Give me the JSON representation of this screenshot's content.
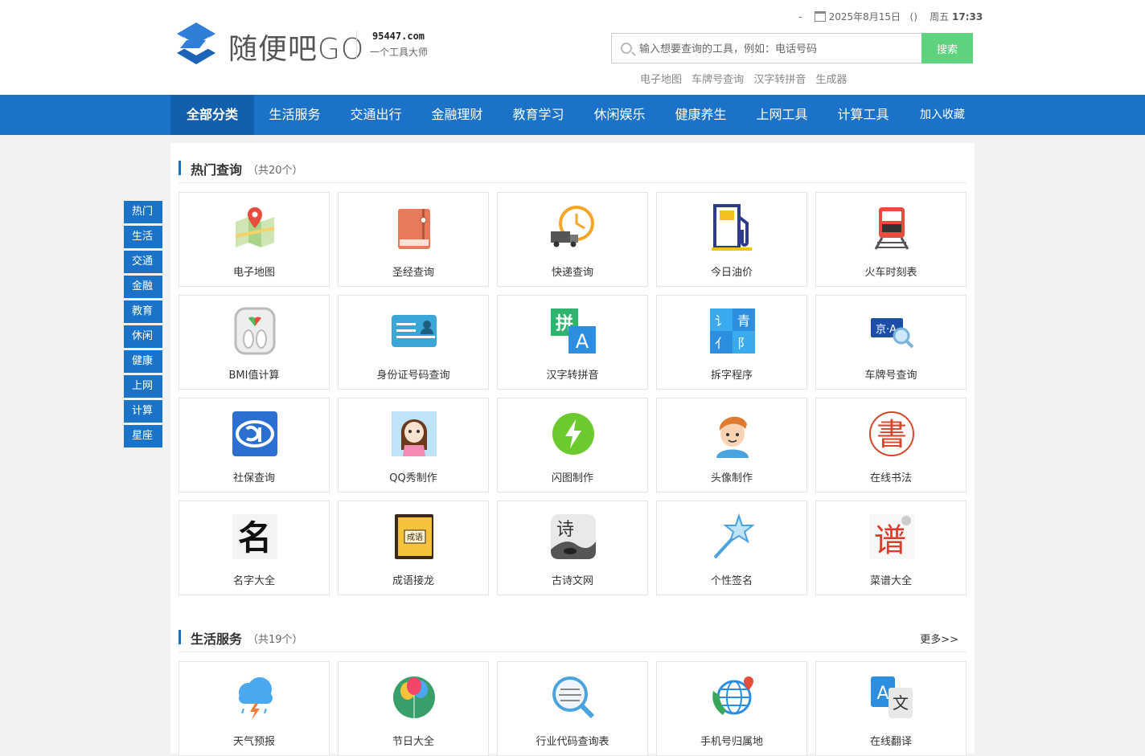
{
  "header": {
    "logo_text": "随便吧GO",
    "domain": "95447.com",
    "slogan": "一个工具大师",
    "date_prefix": "-",
    "date": "2025年8月15日",
    "date_paren": "()",
    "weekday": "周五",
    "time": "17:33",
    "search_placeholder": "输入想要查询的工具，例如：电话号码",
    "search_button": "搜索",
    "quick_links": [
      "电子地图",
      "车牌号查询",
      "汉字转拼音",
      "生成器"
    ]
  },
  "nav": {
    "items": [
      "全部分类",
      "生活服务",
      "交通出行",
      "金融理财",
      "教育学习",
      "休闲娱乐",
      "健康养生",
      "上网工具",
      "计算工具",
      "加入收藏"
    ]
  },
  "sidebar": {
    "items": [
      "热门",
      "生活",
      "交通",
      "金融",
      "教育",
      "休闲",
      "健康",
      "上网",
      "计算",
      "星座"
    ]
  },
  "sections": {
    "hot": {
      "title": "热门查询",
      "count": "（共20个）",
      "tools": [
        "电子地图",
        "圣经查询",
        "快递查询",
        "今日油价",
        "火车时刻表",
        "BMI值计算",
        "身份证号码查询",
        "汉字转拼音",
        "拆字程序",
        "车牌号查询",
        "社保查询",
        "QQ秀制作",
        "闪图制作",
        "头像制作",
        "在线书法",
        "名字大全",
        "成语接龙",
        "古诗文网",
        "个性签名",
        "菜谱大全"
      ]
    },
    "life": {
      "title": "生活服务",
      "count": "（共19个）",
      "more": "更多>>",
      "tools": [
        "天气预报",
        "节日大全",
        "行业代码查询表",
        "手机号归属地",
        "在线翻译"
      ]
    }
  },
  "icons": {
    "hot": [
      "map-icon",
      "bible-icon",
      "express-icon",
      "fuel-icon",
      "train-icon",
      "scale-icon",
      "id-card-icon",
      "pinyin-icon",
      "split-char-icon",
      "plate-search-icon",
      "social-security-icon",
      "qq-show-icon",
      "flash-icon",
      "avatar-icon",
      "calligraphy-icon",
      "name-icon",
      "idiom-book-icon",
      "poem-icon",
      "star-wand-icon",
      "recipe-icon"
    ],
    "life": [
      "weather-icon",
      "balloon-icon",
      "code-search-icon",
      "phone-globe-icon",
      "translate-icon"
    ]
  },
  "icon_text": {
    "pinyin_a": "拼",
    "pinyin_b": "A",
    "split": [
      "讠",
      "青",
      "亻",
      "阝"
    ],
    "plate": "京·A",
    "calligraphy": "書",
    "name": "名",
    "idiom": "成语",
    "poem": "诗",
    "recipe": "谱",
    "translate_a": "A",
    "translate_b": "文"
  },
  "colors": {
    "nav_blue": "#1a73c9",
    "nav_active": "#1260ad",
    "search_green": "#5ed27d"
  }
}
